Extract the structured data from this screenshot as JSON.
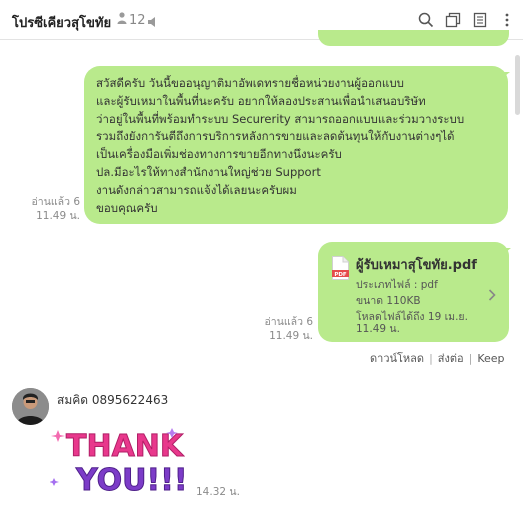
{
  "header": {
    "title": "โปรซีเคียวสุโขทัย",
    "member_count": "12"
  },
  "messages": [
    {
      "lines": [
        "สวัสดีครับ วันนี้ขออนุญาติมาอัพเดทรายชื่อหน่วยงานผู้ออกแบบ",
        "และผู้รับเหมาในพื้นที่นะครับ อยากให้ลองประสานเพื่อนำเสนอบริษัท",
        "ว่าอยู่ในพื้นที่พร้อมทำระบบ Securerity สามารถออกแบบและร่วมวางระบบ",
        "รวมถึงยังการันตีถึงการบริการหลังการขายและลดต้นทุนให้กับงานต่างๆได้",
        "เป็นเครื่องมือเพิ่มช่องทางการขายอีกทางนึงนะครับ",
        "ปล.มีอะไรให้ทางสำนักงานใหญ่ช่วย Support",
        "งานดังกล่าวสามารถแจ้งได้เลยนะครับผม",
        "ขอบคุณครับ"
      ],
      "read": "อ่านแล้ว 6",
      "time": "11.49 น."
    }
  ],
  "file": {
    "name": "ผู้รับเหมาสุโขทัย.pdf",
    "type_line": "ประเภทไฟล์ : pdf",
    "size_line": "ขนาด 110KB",
    "expiry_line1": "โหลดไฟล์ได้ถึง 19 เม.ย.",
    "expiry_line2": "11.49 น.",
    "read": "อ่านแล้ว 6",
    "time": "11.49 น.",
    "actions": {
      "download": "ดาวน์โหลด",
      "share": "ส่งต่อ",
      "keep": "Keep"
    }
  },
  "sticker_message": {
    "sender": "สมคิด 0895622463",
    "sticker_text": [
      "THANK",
      "YOU!!!"
    ],
    "time": "14.32 น."
  },
  "colors": {
    "bubble": "#b9ea8c",
    "pdf_red": "#e54b4b"
  },
  "icons": [
    "person-icon",
    "mute-icon",
    "search-icon",
    "copy-icon",
    "notes-icon",
    "menu-icon",
    "pdf-icon",
    "chevron-right-icon"
  ]
}
